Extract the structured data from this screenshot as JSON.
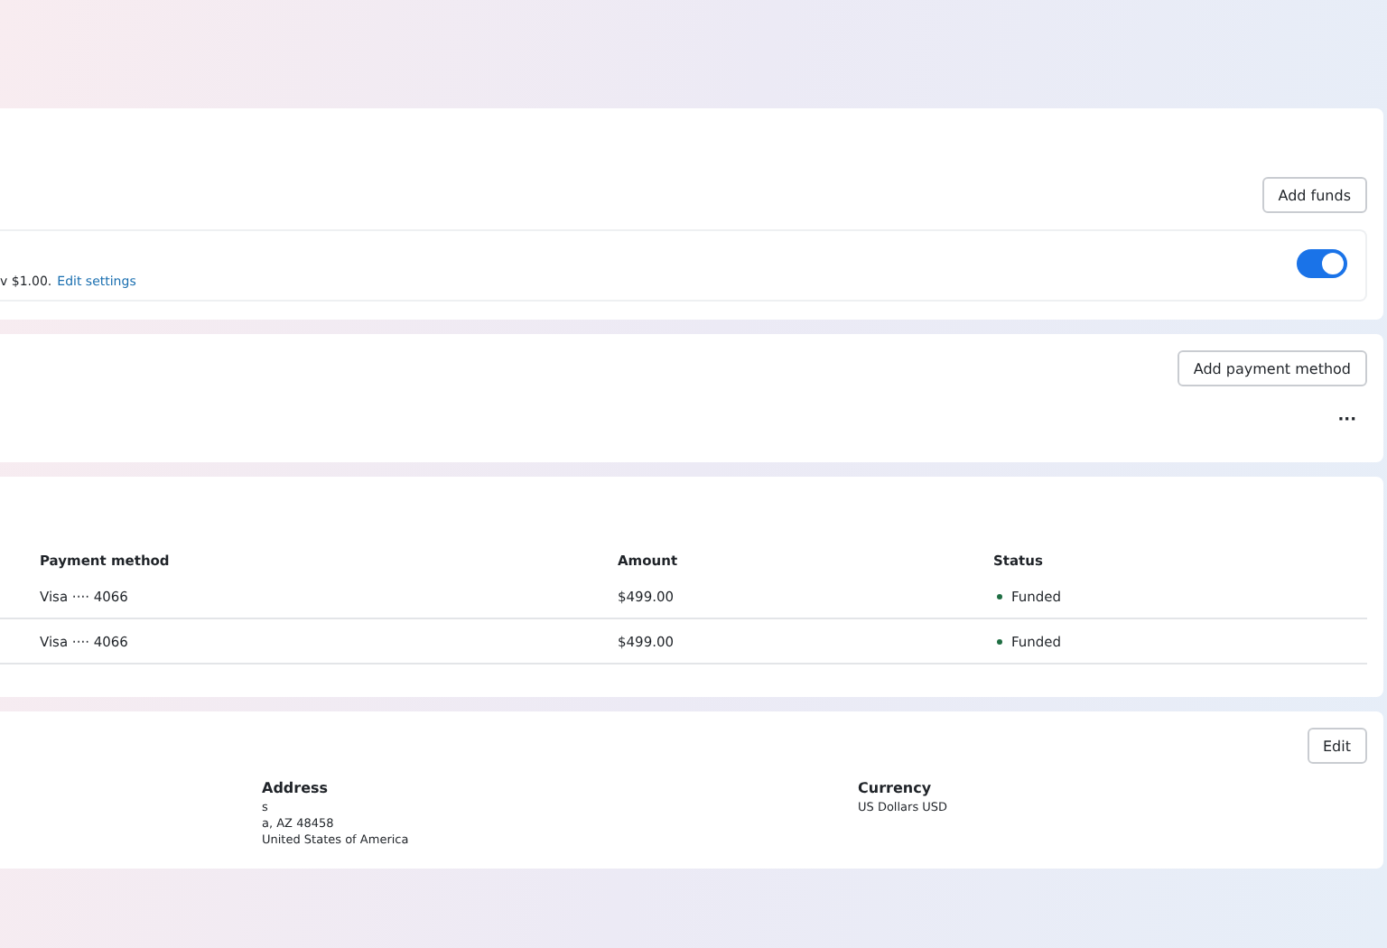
{
  "funds_card": {
    "add_button": "Add funds",
    "auto_reload": {
      "text": "v $1.00.",
      "link": "Edit settings",
      "on": true
    }
  },
  "payment_card": {
    "add_button": "Add payment method",
    "more": "···"
  },
  "history_table": {
    "columns": [
      "Payment method",
      "Amount",
      "Status"
    ],
    "rows": [
      {
        "method": "Visa ···· 4066",
        "amount": "$499.00",
        "status": "Funded",
        "color": "#1f6e43"
      },
      {
        "method": "Visa ···· 4066",
        "amount": "$499.00",
        "status": "Funded",
        "color": "#1f6e43"
      }
    ]
  },
  "billing_card": {
    "edit_button": "Edit",
    "fields": [
      {
        "label": "Address",
        "lines": [
          "s",
          "a, AZ 48458",
          "United States of America"
        ]
      },
      {
        "label": "Currency",
        "lines": [
          "US Dollars USD"
        ]
      }
    ]
  }
}
